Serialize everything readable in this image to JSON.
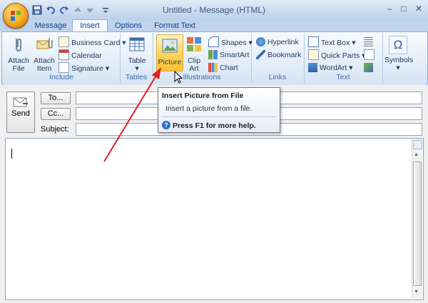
{
  "window": {
    "title": "Untitled - Message (HTML)",
    "controls": {
      "minimize": "–",
      "maximize": "□",
      "close": "✕"
    }
  },
  "quick_access": {
    "items": [
      "save-icon",
      "undo-icon",
      "redo-icon",
      "up-icon",
      "down-icon",
      "customize-icon"
    ]
  },
  "tabs": [
    {
      "label": "Message",
      "active": false
    },
    {
      "label": "Insert",
      "active": true
    },
    {
      "label": "Options",
      "active": false
    },
    {
      "label": "Format Text",
      "active": false
    }
  ],
  "ribbon": {
    "include": {
      "label": "Include",
      "attach_file": "Attach File",
      "attach_item": "Attach Item",
      "business_card": "Business Card",
      "calendar": "Calendar",
      "signature": "Signature"
    },
    "tables": {
      "label": "Tables",
      "table": "Table"
    },
    "illustrations": {
      "label": "Illustrations",
      "picture": "Picture",
      "clip_art": "Clip Art",
      "shapes": "Shapes",
      "smartart": "SmartArt",
      "chart": "Chart"
    },
    "links": {
      "label": "Links",
      "hyperlink": "Hyperlink",
      "bookmark": "Bookmark"
    },
    "text": {
      "label": "Text",
      "text_box": "Text Box",
      "quick_parts": "Quick Parts",
      "wordart": "WordArt"
    },
    "symbols": {
      "label": "Symbols"
    }
  },
  "header": {
    "send": "Send",
    "to": "To...",
    "cc": "Cc...",
    "subject": "Subject:",
    "to_value": "",
    "cc_value": "",
    "subject_value": ""
  },
  "tooltip": {
    "title": "Insert Picture from File",
    "description": "Insert a picture from a file.",
    "help": "Press F1 for more help."
  },
  "colors": {
    "highlight": "#ffd65e",
    "arrow": "#e02020",
    "ribbon_border": "#8daed9"
  }
}
